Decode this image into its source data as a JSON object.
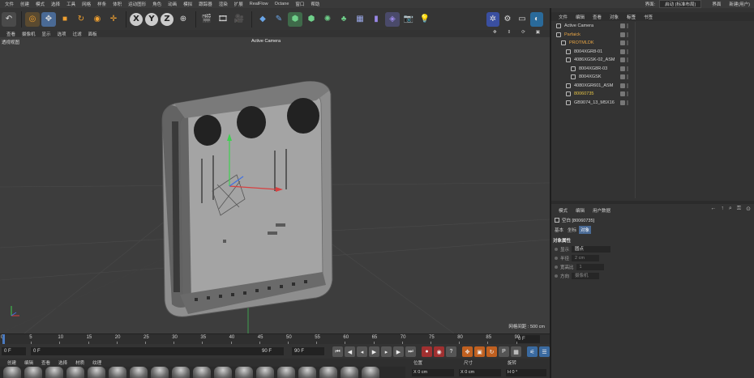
{
  "menu": {
    "items": [
      "文件",
      "创建",
      "模式",
      "选择",
      "工具",
      "网格",
      "样条",
      "体积",
      "运动图形",
      "角色",
      "动画",
      "模拟",
      "跟踪器",
      "渲染",
      "扩展",
      "RealFlow",
      "Octane",
      "窗口",
      "帮助"
    ],
    "layout_label": "界面:",
    "layout_value": "启动 (标准布局)",
    "right_items": [
      "界面",
      "新建(用户)"
    ]
  },
  "toolbar": {
    "axes": [
      "X",
      "Y",
      "Z"
    ]
  },
  "viewport": {
    "menu": [
      "查看",
      "摄像机",
      "显示",
      "选项",
      "过滤",
      "面板"
    ],
    "label": "透视视图",
    "camera": "Active Camera",
    "scale": "网格间距 : 500 cm"
  },
  "timeline": {
    "ticks": [
      "0",
      "5",
      "10",
      "15",
      "20",
      "25",
      "30",
      "35",
      "40",
      "45",
      "50",
      "55",
      "60",
      "65",
      "70",
      "75",
      "80",
      "85",
      "90"
    ],
    "current_frame": "0 F",
    "start": "0 F",
    "start2": "0 F",
    "end": "90 F",
    "end2": "90 F"
  },
  "materials": {
    "menu": [
      "创建",
      "编辑",
      "查看",
      "选择",
      "材质",
      "纹理"
    ],
    "count": 18
  },
  "coords": {
    "headers": [
      "位置",
      "尺寸",
      "旋转"
    ],
    "x_pos": "X 0 cm",
    "x_size": "X 0 cm",
    "h_rot": "H 0 °"
  },
  "object_manager": {
    "tabs": [
      "文件",
      "编辑",
      "查看",
      "对象",
      "标签",
      "书签"
    ],
    "objects": [
      {
        "name": "Active Camera",
        "indent": 0,
        "color": "#d6d6d6"
      },
      {
        "name": "Parfaick",
        "indent": 0,
        "color": "#e8a545"
      },
      {
        "name": "PROTMLDK",
        "indent": 1,
        "color": "#e8a545"
      },
      {
        "name": "8004XGR8-01",
        "indent": 2,
        "color": "#d6d6d6"
      },
      {
        "name": "4086XGSK-02_ASM",
        "indent": 2,
        "color": "#d6d6d6"
      },
      {
        "name": "8004XG8R-03",
        "indent": 3,
        "color": "#d6d6d6"
      },
      {
        "name": "8004XGSK",
        "indent": 3,
        "color": "#d6d6d6"
      },
      {
        "name": "4080XGR601_ASM",
        "indent": 2,
        "color": "#d6d6d6"
      },
      {
        "name": "80060735",
        "indent": 2,
        "color": "#e8c545"
      },
      {
        "name": "GB9074_13_M5X16",
        "indent": 2,
        "color": "#d6d6d6"
      }
    ]
  },
  "attributes": {
    "tabs": [
      "模式",
      "编辑",
      "用户数据"
    ],
    "title": "空白 [80060735]",
    "subtabs": [
      "基本",
      "坐标",
      "对象"
    ],
    "selected_subtab": "对象",
    "section": "对象属性",
    "props": [
      {
        "label": "显示",
        "value": "圆点"
      },
      {
        "label": "半径",
        "value": "2 cm"
      },
      {
        "label": "宽高比",
        "value": "1"
      },
      {
        "label": "方向",
        "value": "摄像机"
      }
    ]
  }
}
